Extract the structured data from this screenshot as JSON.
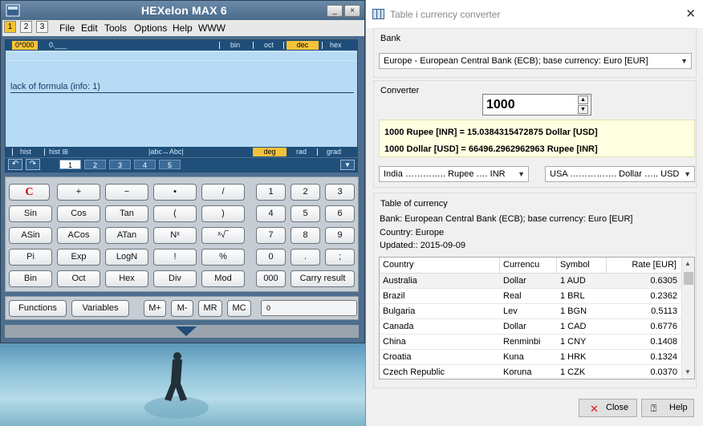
{
  "calc": {
    "title": "HEXelon MAX 6",
    "window_buttons": [
      "_",
      "□",
      "×"
    ],
    "memory_tabs": [
      "1",
      "2",
      "3"
    ],
    "menu": [
      "File",
      "Edit",
      "Tools",
      "Options",
      "Help",
      "WWW"
    ],
    "display": {
      "top_left": "0*000",
      "top_left2": "0.___",
      "bases": [
        "bin",
        "oct",
        "dec",
        "hex"
      ],
      "active_base": "dec",
      "formula": "lack of formula (info: 1)",
      "hist1": "hist",
      "hist2": "hist ⊞",
      "case_toggle": "|abc↔Abc|",
      "angles": [
        "deg",
        "rad",
        "grad"
      ],
      "active_angle": "deg"
    },
    "number_tabs": [
      "1",
      "2",
      "3",
      "4",
      "5"
    ],
    "keys": {
      "c": "C",
      "ops": [
        "+",
        "−",
        "•",
        "/"
      ],
      "func1": [
        "Sin",
        "Cos",
        "Tan",
        "(",
        ")"
      ],
      "func2": [
        "ASin",
        "ACos",
        "ATan",
        "Nˣ",
        "ˣ√‾"
      ],
      "func3": [
        "Pi",
        "Exp",
        "LogN",
        "!",
        "%"
      ],
      "func4": [
        "Bin",
        "Oct",
        "Hex",
        "Div",
        "Mod"
      ],
      "digits": [
        "1",
        "2",
        "3",
        "4",
        "5",
        "6",
        "7",
        "8",
        "9",
        "0",
        ".",
        ";"
      ],
      "zeros": "000",
      "carry": "Carry result"
    },
    "bottom": {
      "functions": "Functions",
      "variables": "Variables",
      "mem": [
        "M+",
        "M-",
        "MR",
        "MC"
      ],
      "mem_value": "0"
    }
  },
  "converter": {
    "title": "Table i currency converter",
    "close_x": "✕",
    "bank_label": "Bank",
    "bank_value": "Europe - European Central Bank (ECB); base currency: Euro [EUR]",
    "converter_label": "Converter",
    "amount": "1000",
    "result_line1": "1000 Rupee [INR] = 15.0384315472875 Dollar [USD]",
    "result_line2": "1000 Dollar [USD] = 66496.2962962963 Rupee [INR]",
    "from_currency": "India ………….. Rupee …. INR",
    "to_currency": "USA ……………. Dollar ….. USD",
    "table_label": "Table of currency",
    "bank_info": "Bank: European Central Bank (ECB); base currency: Euro [EUR]",
    "country_info": "Country: Europe",
    "updated_info": "Updated:: 2015-09-09",
    "columns": [
      "Country",
      "Currencu",
      "Symbol",
      "Rate [EUR]"
    ],
    "rows": [
      [
        "Australia",
        "Dollar",
        "1 AUD",
        "0.6305"
      ],
      [
        "Brazil",
        "Real",
        "1 BRL",
        "0.2362"
      ],
      [
        "Bulgaria",
        "Lev",
        "1 BGN",
        "0.5113"
      ],
      [
        "Canada",
        "Dollar",
        "1 CAD",
        "0.6776"
      ],
      [
        "China",
        "Renminbi",
        "1 CNY",
        "0.1408"
      ],
      [
        "Croatia",
        "Kuna",
        "1 HRK",
        "0.1324"
      ],
      [
        "Czech Republic",
        "Koruna",
        "1 CZK",
        "0.0370"
      ]
    ],
    "close_button": "Close",
    "help_button": "Help"
  }
}
